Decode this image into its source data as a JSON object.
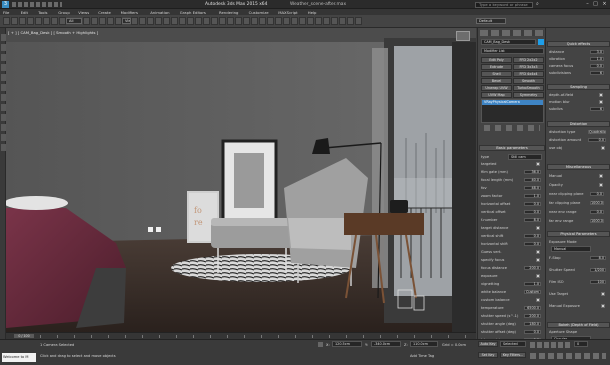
{
  "titlebar": {
    "title": "Autodesk 3ds Max 2015 x64",
    "filename": "Weather_scene-after.max",
    "search_placeholder": "Type a keyword or phrase"
  },
  "menu": [
    "File",
    "Edit",
    "Tools",
    "Group",
    "Views",
    "Create",
    "Modifiers",
    "Animation",
    "Graph Editors",
    "Rendering",
    "Customize",
    "MAXScript",
    "Help"
  ],
  "toolbar": {
    "filter_value": "All",
    "view_value": "View",
    "workspace_label": "Default"
  },
  "viewport": {
    "label": "[ + ] [ CAM_Bag_Desk ] [ Smooth + Highlights ]",
    "colors": {
      "wall": "#5e5e5e",
      "floor": "#3b302c",
      "window": "#8e9296",
      "bed": "#6b2a3c"
    }
  },
  "modify_panel": {
    "object_name": "CAM_Bag_Desk",
    "modifier_list": "Modifier List",
    "buttons": [
      "Edit Poly",
      "FFD 2x2x2",
      "Extrude",
      "FFD 3x3x3",
      "Shell",
      "FFD 4x4x4",
      "Bevel",
      "Smooth",
      "Unwrap UVW",
      "TurboSmooth",
      "UVW Map",
      "Symmetry"
    ],
    "stack_item": "VRayPhysicalCamera",
    "rollout_title": "Basic parameters",
    "type_label": "type",
    "type_value": "Still cam",
    "params": [
      {
        "label": "targeted",
        "value": ""
      },
      {
        "label": "film gate (mm)",
        "value": "36.0"
      },
      {
        "label": "focal length (mm)",
        "value": "40.0"
      },
      {
        "label": "fov",
        "value": "48.0"
      },
      {
        "label": "zoom factor",
        "value": "1.0"
      },
      {
        "label": "horizontal offset",
        "value": "0.0"
      },
      {
        "label": "vertical offset",
        "value": "0.0"
      },
      {
        "label": "f-number",
        "value": "8.0"
      },
      {
        "label": "target distance",
        "value": ""
      },
      {
        "label": "vertical shift",
        "value": "0.0"
      },
      {
        "label": "horizontal shift",
        "value": "0.0"
      },
      {
        "label": "Guess vert.",
        "value": ""
      },
      {
        "label": "specify focus",
        "value": ""
      },
      {
        "label": "focus distance",
        "value": "200.0"
      },
      {
        "label": "exposure",
        "value": ""
      },
      {
        "label": "vignetting",
        "value": "1.0"
      },
      {
        "label": "white balance",
        "value": "Custom"
      },
      {
        "label": "custom balance",
        "value": ""
      },
      {
        "label": "temperature",
        "value": "6500.0"
      },
      {
        "label": "shutter speed (s^-1)",
        "value": "200.0"
      },
      {
        "label": "shutter angle (deg)",
        "value": "180.0"
      },
      {
        "label": "shutter offset (deg)",
        "value": "0.0"
      },
      {
        "label": "latency (s)",
        "value": "0.0"
      },
      {
        "label": "film speed (ISO)",
        "value": "100.0"
      }
    ]
  },
  "far_panel": {
    "quick_effects": "Quick effects",
    "qe_rows": [
      {
        "label": "distance",
        "value": "3.0"
      },
      {
        "label": "vibration",
        "value": "1.0"
      },
      {
        "label": "camera focus",
        "value": "0.0"
      },
      {
        "label": "subdivisions",
        "value": "6"
      }
    ],
    "sampling": "Sampling",
    "sampling_rows": [
      {
        "label": "depth-of-field",
        "value": ""
      },
      {
        "label": "motion blur",
        "value": ""
      },
      {
        "label": "subdivs",
        "value": "6"
      }
    ],
    "distortion": "Distortion",
    "dist_rows": [
      {
        "label": "distortion type",
        "value": "Quadratic"
      },
      {
        "label": "distortion amount",
        "value": "0.0"
      },
      {
        "label": "use obj",
        "value": ""
      }
    ],
    "misc": "Miscellaneous",
    "misc_rows": [
      {
        "label": "Manual",
        "value": ""
      },
      {
        "label": "Opacity",
        "value": ""
      },
      {
        "label": "near clipping plane",
        "value": "0.0"
      },
      {
        "label": "far clipping plane",
        "value": "1000.0"
      },
      {
        "label": "near env range",
        "value": "0.0"
      },
      {
        "label": "far env range",
        "value": "1000.0"
      }
    ],
    "phys_params": "Physical Parameters",
    "exposure_mode": "Exposure Mode",
    "exposure_value": "Manual",
    "p_rows": [
      {
        "label": "F-Stop",
        "value": "8.0"
      },
      {
        "label": "Shutter Speed",
        "value": "1/200"
      },
      {
        "label": "Film ISO",
        "value": "100"
      },
      {
        "label": "Use Target",
        "value": ""
      },
      {
        "label": "Manual Exposure",
        "value": ""
      }
    ],
    "bokeh": "Bokeh (Depth of Field)",
    "aperture_shape": "Aperture Shape",
    "aperture_value": "Circular"
  },
  "statusbar": {
    "selection": "1 Camera Selected",
    "prompt": "Click and drag to select and move objects",
    "x_val": "120.5cm",
    "y_val": "-340.0cm",
    "z_val": "110.0cm",
    "grid": "Grid = 0.0cm",
    "autokey": "Auto Key",
    "selected": "Selected",
    "setkey": "Set Key",
    "keyfilters": "Key Filters...",
    "frame": "0",
    "timeline_pos": "0 / 100",
    "tag_label": "Add Time Tag",
    "welcome": "Welcome to M"
  }
}
